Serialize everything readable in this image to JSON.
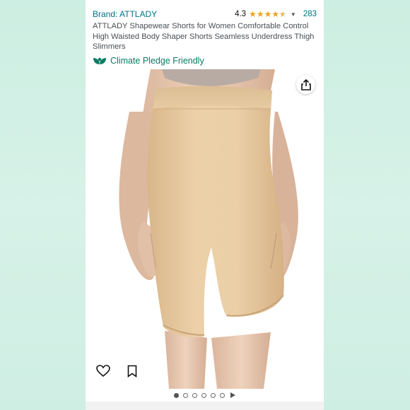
{
  "product": {
    "brand_label": "Brand: ATTLADY",
    "rating_value": "4.3",
    "rating_stars": 4.3,
    "review_count": "283",
    "title": "ATTLADY Shapewear Shorts for Women Comfortable Control High Waisted Body Shaper Shorts Seamless Underdress Thigh Slimmers",
    "pledge_label": "Climate Pledge Friendly"
  },
  "gallery": {
    "image_count": 6,
    "active_index": 0,
    "has_video": true
  },
  "icons": {
    "share": "share-icon",
    "wishlist": "heart-icon",
    "save": "bookmark-icon",
    "pledge": "leaf-icon"
  },
  "colors": {
    "link": "#007185",
    "pledge": "#067d62",
    "star": "#f0a41c",
    "garment": "#e8caa1",
    "background_mint": "#cdeee2"
  }
}
